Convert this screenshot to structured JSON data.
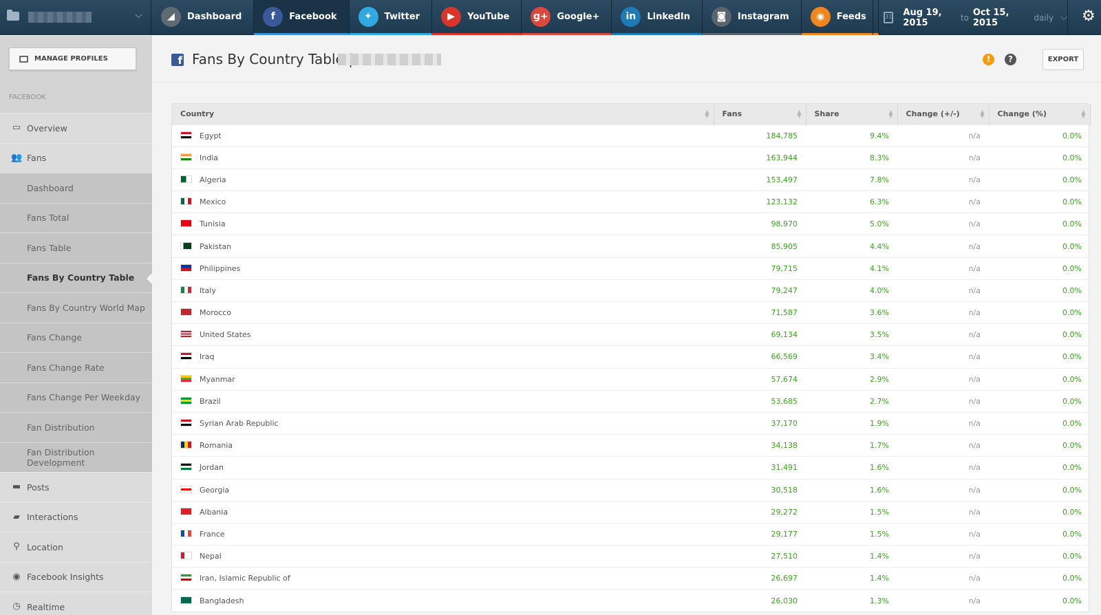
{
  "topbar": {
    "tabs": [
      {
        "label": "Dashboard",
        "icon": "chart-icon",
        "icon_bg": "#5f6b73",
        "accent": ""
      },
      {
        "label": "Facebook",
        "icon": "facebook-icon",
        "icon_bg": "#3b5998",
        "accent": "#3b8fd9"
      },
      {
        "label": "Twitter",
        "icon": "twitter-icon",
        "icon_bg": "#2fa9e0",
        "accent": "#2fa9e0"
      },
      {
        "label": "YouTube",
        "icon": "youtube-icon",
        "icon_bg": "#d9352b",
        "accent": "#d9352b"
      },
      {
        "label": "Google+",
        "icon": "googleplus-icon",
        "icon_bg": "#d9483b",
        "accent": "#d9483b"
      },
      {
        "label": "LinkedIn",
        "icon": "linkedin-icon",
        "icon_bg": "#1f7bb6",
        "accent": "#1f7bb6"
      },
      {
        "label": "Instagram",
        "icon": "instagram-icon",
        "icon_bg": "#5a646c",
        "accent": "#5a646c"
      },
      {
        "label": "Feeds",
        "icon": "rss-icon",
        "icon_bg": "#f0861e",
        "accent": "#f0861e"
      }
    ],
    "date_from": "Aug 19, 2015",
    "date_to_word": "to",
    "date_to": "Oct 15, 2015",
    "period": "daily"
  },
  "sidebar": {
    "manage_label": "MANAGE PROFILES",
    "section": "FACEBOOK",
    "items": [
      {
        "label": "Overview",
        "icon": "monitor-icon",
        "glyph": "▭",
        "type": "main"
      },
      {
        "label": "Fans",
        "icon": "users-icon",
        "glyph": "👥",
        "type": "main"
      },
      {
        "label": "Dashboard",
        "type": "sub"
      },
      {
        "label": "Fans Total",
        "type": "sub"
      },
      {
        "label": "Fans Table",
        "type": "sub"
      },
      {
        "label": "Fans By Country Table",
        "type": "sub",
        "active": true
      },
      {
        "label": "Fans By Country World Map",
        "type": "sub"
      },
      {
        "label": "Fans Change",
        "type": "sub"
      },
      {
        "label": "Fans Change Rate",
        "type": "sub"
      },
      {
        "label": "Fans Change Per Weekday",
        "type": "sub"
      },
      {
        "label": "Fan Distribution",
        "type": "sub"
      },
      {
        "label": "Fan Distribution Development",
        "type": "sub"
      },
      {
        "label": "Posts",
        "icon": "comment-icon",
        "glyph": "▬",
        "type": "main"
      },
      {
        "label": "Interactions",
        "icon": "comments-icon",
        "glyph": "▰",
        "type": "main"
      },
      {
        "label": "Location",
        "icon": "pin-icon",
        "glyph": "⚲",
        "type": "main"
      },
      {
        "label": "Facebook Insights",
        "icon": "eye-icon",
        "glyph": "◉",
        "type": "main"
      },
      {
        "label": "Realtime",
        "icon": "clock-icon",
        "glyph": "◷",
        "type": "main"
      }
    ]
  },
  "main": {
    "title": "Fans By Country Table |",
    "export_label": "EXPORT",
    "columns": [
      "Country",
      "Fans",
      "Share",
      "Change (+/-)",
      "Change (%)"
    ],
    "rows": [
      {
        "country": "Egypt",
        "fans": "184,785",
        "share": "9.4%",
        "change": "n/a",
        "change_pct": "0.0%",
        "flag": [
          "#ce1126",
          "#ffffff",
          "#000000"
        ],
        "orient": "h"
      },
      {
        "country": "India",
        "fans": "163,944",
        "share": "8.3%",
        "change": "n/a",
        "change_pct": "0.0%",
        "flag": [
          "#ff9933",
          "#ffffff",
          "#138808"
        ],
        "orient": "h"
      },
      {
        "country": "Algeria",
        "fans": "153,497",
        "share": "7.8%",
        "change": "n/a",
        "change_pct": "0.0%",
        "flag": [
          "#006233",
          "#ffffff"
        ],
        "orient": "v"
      },
      {
        "country": "Mexico",
        "fans": "123,132",
        "share": "6.3%",
        "change": "n/a",
        "change_pct": "0.0%",
        "flag": [
          "#006847",
          "#ffffff",
          "#ce1126"
        ],
        "orient": "v"
      },
      {
        "country": "Tunisia",
        "fans": "98,970",
        "share": "5.0%",
        "change": "n/a",
        "change_pct": "0.0%",
        "flag": [
          "#e70013"
        ],
        "orient": "h"
      },
      {
        "country": "Pakistan",
        "fans": "85,905",
        "share": "4.4%",
        "change": "n/a",
        "change_pct": "0.0%",
        "flag": [
          "#ffffff",
          "#01411c",
          "#01411c",
          "#01411c"
        ],
        "orient": "v"
      },
      {
        "country": "Philippines",
        "fans": "79,715",
        "share": "4.1%",
        "change": "n/a",
        "change_pct": "0.0%",
        "flag": [
          "#0038a8",
          "#ce1126"
        ],
        "orient": "h"
      },
      {
        "country": "Italy",
        "fans": "79,247",
        "share": "4.0%",
        "change": "n/a",
        "change_pct": "0.0%",
        "flag": [
          "#009246",
          "#ffffff",
          "#ce2b37"
        ],
        "orient": "v"
      },
      {
        "country": "Morocco",
        "fans": "71,587",
        "share": "3.6%",
        "change": "n/a",
        "change_pct": "0.0%",
        "flag": [
          "#c1272d"
        ],
        "orient": "h"
      },
      {
        "country": "United States",
        "fans": "69,134",
        "share": "3.5%",
        "change": "n/a",
        "change_pct": "0.0%",
        "flag": [
          "#b22234",
          "#ffffff",
          "#b22234",
          "#ffffff",
          "#b22234"
        ],
        "orient": "h"
      },
      {
        "country": "Iraq",
        "fans": "66,569",
        "share": "3.4%",
        "change": "n/a",
        "change_pct": "0.0%",
        "flag": [
          "#ce1126",
          "#ffffff",
          "#000000"
        ],
        "orient": "h"
      },
      {
        "country": "Myanmar",
        "fans": "57,674",
        "share": "2.9%",
        "change": "n/a",
        "change_pct": "0.0%",
        "flag": [
          "#fecb00",
          "#34b233",
          "#ea2839"
        ],
        "orient": "h"
      },
      {
        "country": "Brazil",
        "fans": "53,685",
        "share": "2.7%",
        "change": "n/a",
        "change_pct": "0.0%",
        "flag": [
          "#009c3b",
          "#ffdf00",
          "#009c3b"
        ],
        "orient": "h"
      },
      {
        "country": "Syrian Arab Republic",
        "fans": "37,170",
        "share": "1.9%",
        "change": "n/a",
        "change_pct": "0.0%",
        "flag": [
          "#ce1126",
          "#ffffff",
          "#000000"
        ],
        "orient": "h"
      },
      {
        "country": "Romania",
        "fans": "34,138",
        "share": "1.7%",
        "change": "n/a",
        "change_pct": "0.0%",
        "flag": [
          "#002b7f",
          "#fcd116",
          "#ce1126"
        ],
        "orient": "v"
      },
      {
        "country": "Jordan",
        "fans": "31,491",
        "share": "1.6%",
        "change": "n/a",
        "change_pct": "0.0%",
        "flag": [
          "#000000",
          "#ffffff",
          "#007a3d"
        ],
        "orient": "h"
      },
      {
        "country": "Georgia",
        "fans": "30,518",
        "share": "1.6%",
        "change": "n/a",
        "change_pct": "0.0%",
        "flag": [
          "#ffffff",
          "#ff0000",
          "#ffffff"
        ],
        "orient": "h"
      },
      {
        "country": "Albania",
        "fans": "29,272",
        "share": "1.5%",
        "change": "n/a",
        "change_pct": "0.0%",
        "flag": [
          "#e41e20"
        ],
        "orient": "h"
      },
      {
        "country": "France",
        "fans": "29,177",
        "share": "1.5%",
        "change": "n/a",
        "change_pct": "0.0%",
        "flag": [
          "#0055a4",
          "#ffffff",
          "#ef4135"
        ],
        "orient": "v"
      },
      {
        "country": "Nepal",
        "fans": "27,510",
        "share": "1.4%",
        "change": "n/a",
        "change_pct": "0.0%",
        "flag": [
          "#dc143c",
          "#ffffff",
          "#ffffff"
        ],
        "orient": "v"
      },
      {
        "country": "Iran, Islamic Republic of",
        "fans": "26,697",
        "share": "1.4%",
        "change": "n/a",
        "change_pct": "0.0%",
        "flag": [
          "#239f40",
          "#ffffff",
          "#da0000"
        ],
        "orient": "h"
      },
      {
        "country": "Bangladesh",
        "fans": "26,030",
        "share": "1.3%",
        "change": "n/a",
        "change_pct": "0.0%",
        "flag": [
          "#006a4e"
        ],
        "orient": "h"
      }
    ]
  }
}
